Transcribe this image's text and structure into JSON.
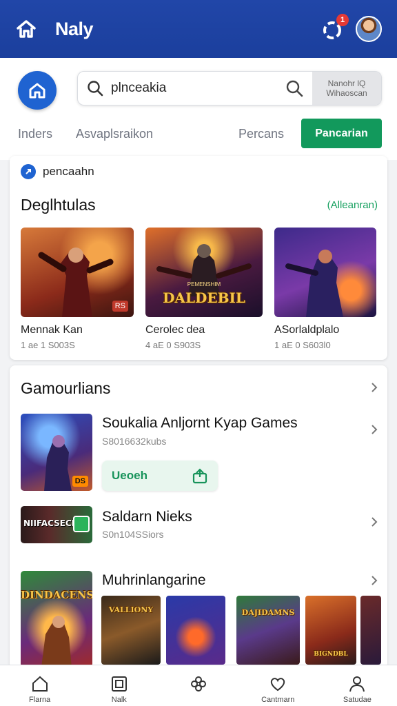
{
  "header": {
    "title": "Naly",
    "notification_count": "1",
    "icons": {
      "home": "home-icon",
      "notifications": "notification-icon",
      "avatar": "avatar"
    }
  },
  "search": {
    "query": "plnceakia",
    "filter_label": "Nanohr lQ Wihaoscan"
  },
  "tabs": {
    "items": [
      "Inders",
      "Asvaplsraikon",
      "Percans"
    ],
    "primary_label": "Pancarian"
  },
  "featured": {
    "chip_label": "pencaahn",
    "title": "Deglhtulas",
    "see_all": "(Alleanran)",
    "items": [
      {
        "name": "Mennak Kan",
        "meta": "1 ae 1 S003S",
        "tag": "RS"
      },
      {
        "name": "Cerolec dea",
        "meta": "4 aE 0 S903S",
        "art_text": "DALDEBIL",
        "art_sub": "PEMENSHIM"
      },
      {
        "name": "ASorlaldplalo",
        "meta": "1 aE 0 S603l0"
      }
    ]
  },
  "game_list": {
    "title": "Gamourlians",
    "items": [
      {
        "title": "Soukalia Anljornt Kyap Games",
        "meta": "S8016632kubs",
        "button": "Ueoeh",
        "badge": "DS"
      },
      {
        "title": "Saldarn Nieks",
        "meta": "S0n104SSiors",
        "art_text": "NIIFACSECN"
      }
    ]
  },
  "more": {
    "title": "Muhrinlangarine",
    "hero_art_text": "DINDACENS",
    "strip": [
      "VALLIONY",
      "",
      "DAJIDAMNS",
      "BIGNDBL",
      ""
    ]
  },
  "bottom_nav": [
    {
      "label": "Flarna",
      "icon": "home-icon"
    },
    {
      "label": "Nalk",
      "icon": "square-icon"
    },
    {
      "label": "",
      "icon": "flower-icon"
    },
    {
      "label": "Cantmarn",
      "icon": "heart-icon"
    },
    {
      "label": "Satudae",
      "icon": "person-icon"
    }
  ],
  "colors": {
    "topbar": "#1b3f9d",
    "accent_green": "#12995c",
    "accent_blue": "#1f63d1"
  }
}
